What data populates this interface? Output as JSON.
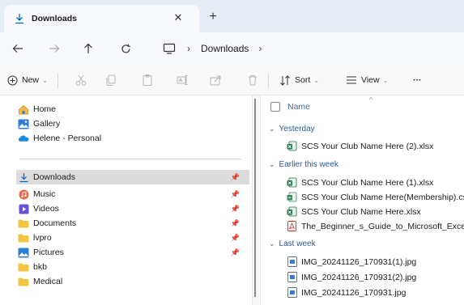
{
  "tab": {
    "title": "Downloads",
    "close": "✕",
    "new": "+"
  },
  "address": {
    "separator": "›",
    "crumb": "Downloads",
    "trailing": "›"
  },
  "toolbar": {
    "new_label": "New",
    "sort_label": "Sort",
    "view_label": "View",
    "more_label": "···"
  },
  "nav": {
    "top": [
      {
        "label": "Home",
        "icon": "home-icon"
      },
      {
        "label": "Gallery",
        "icon": "gallery-icon"
      },
      {
        "label": "Helene - Personal",
        "icon": "onedrive-icon"
      }
    ],
    "quick": [
      {
        "label": "Downloads",
        "icon": "download-icon",
        "pinned": true,
        "selected": true
      },
      {
        "label": "Music",
        "icon": "music-icon",
        "pinned": true
      },
      {
        "label": "Videos",
        "icon": "videos-icon",
        "pinned": true
      },
      {
        "label": "Documents",
        "icon": "folder-icon",
        "pinned": true
      },
      {
        "label": "lvpro",
        "icon": "folder-icon",
        "pinned": true
      },
      {
        "label": "Pictures",
        "icon": "pictures-icon",
        "pinned": true
      },
      {
        "label": "bkb",
        "icon": "folder-icon",
        "pinned": false
      },
      {
        "label": "Medical",
        "icon": "folder-icon",
        "pinned": false
      }
    ]
  },
  "content": {
    "column_name": "Name",
    "groups": [
      {
        "label": "Yesterday",
        "files": [
          {
            "name": "SCS Your Club Name Here (2).xlsx",
            "icon": "excel-icon"
          }
        ]
      },
      {
        "label": "Earlier this week",
        "files": [
          {
            "name": "SCS Your Club Name Here (1).xlsx",
            "icon": "excel-icon"
          },
          {
            "name": "SCS Your Club Name Here(Membership).csv",
            "icon": "csv-icon"
          },
          {
            "name": "SCS Your Club Name Here.xlsx",
            "icon": "excel-icon"
          },
          {
            "name": "The_Beginner_s_Guide_to_Microsoft_Excel.pdf",
            "icon": "pdf-icon"
          }
        ]
      },
      {
        "label": "Last week",
        "files": [
          {
            "name": "IMG_20241126_170931(1).jpg",
            "icon": "image-icon"
          },
          {
            "name": "IMG_20241126_170931(2).jpg",
            "icon": "image-icon"
          },
          {
            "name": "IMG_20241126_170931.jpg",
            "icon": "image-icon"
          }
        ]
      }
    ]
  },
  "colors": {
    "accent": "#0067c0",
    "folder": "#f4c542",
    "excel": "#1d7044",
    "pdf": "#d93025",
    "selected": "#dcdcdc"
  }
}
